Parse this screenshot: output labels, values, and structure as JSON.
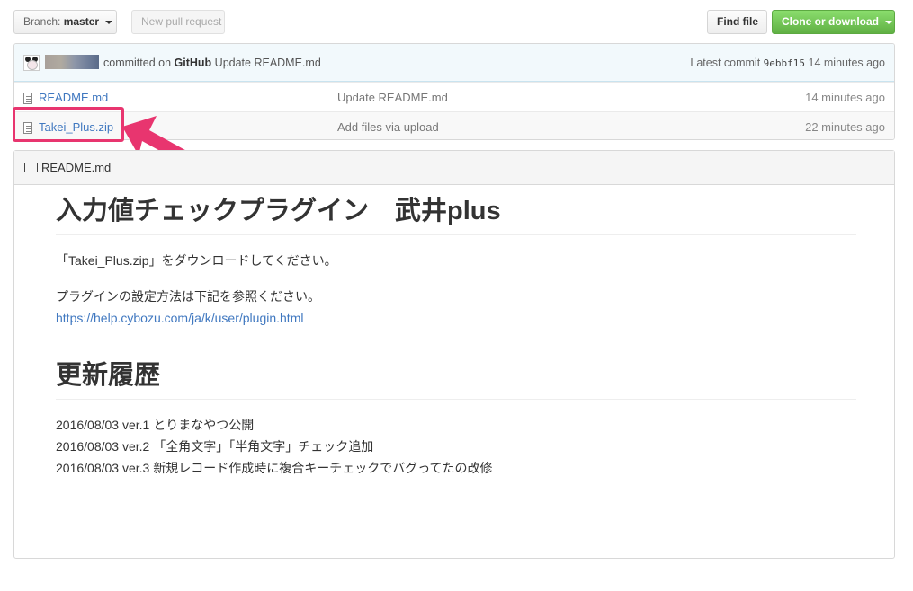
{
  "toolbar": {
    "branch_prefix": "Branch:",
    "branch_name": "master",
    "new_pr_label": "New pull request",
    "find_file_label": "Find file",
    "clone_label": "Clone or download"
  },
  "commit": {
    "committed_text": "committed on",
    "platform": "GitHub",
    "message": "Update README.md",
    "latest_label": "Latest commit",
    "sha": "9ebbf15",
    "age": "14 minutes ago"
  },
  "files": [
    {
      "name": "README.md",
      "message": "Update README.md",
      "age": "14 minutes ago"
    },
    {
      "name": "Takei_Plus.zip",
      "message": "Add files via upload",
      "age": "22 minutes ago"
    }
  ],
  "readme": {
    "header": "README.md",
    "title": "入力値チェックプラグイン　武井plus",
    "download_text": "「Takei_Plus.zip」をダウンロードしてください。",
    "settings_text": "プラグインの設定方法は下記を参照ください。",
    "settings_link": "https://help.cybozu.com/ja/k/user/plugin.html",
    "history_title": "更新履歴",
    "history": [
      "2016/08/03 ver.1 とりまなやつ公開",
      "2016/08/03 ver.2 「全角文字」「半角文字」チェック追加",
      "2016/08/03 ver.3 新規レコード作成時に複合キーチェックでバグってたの改修"
    ]
  },
  "colors": {
    "highlight": "#e8356f",
    "link": "#4078c0",
    "clone_button": "#60b044"
  }
}
